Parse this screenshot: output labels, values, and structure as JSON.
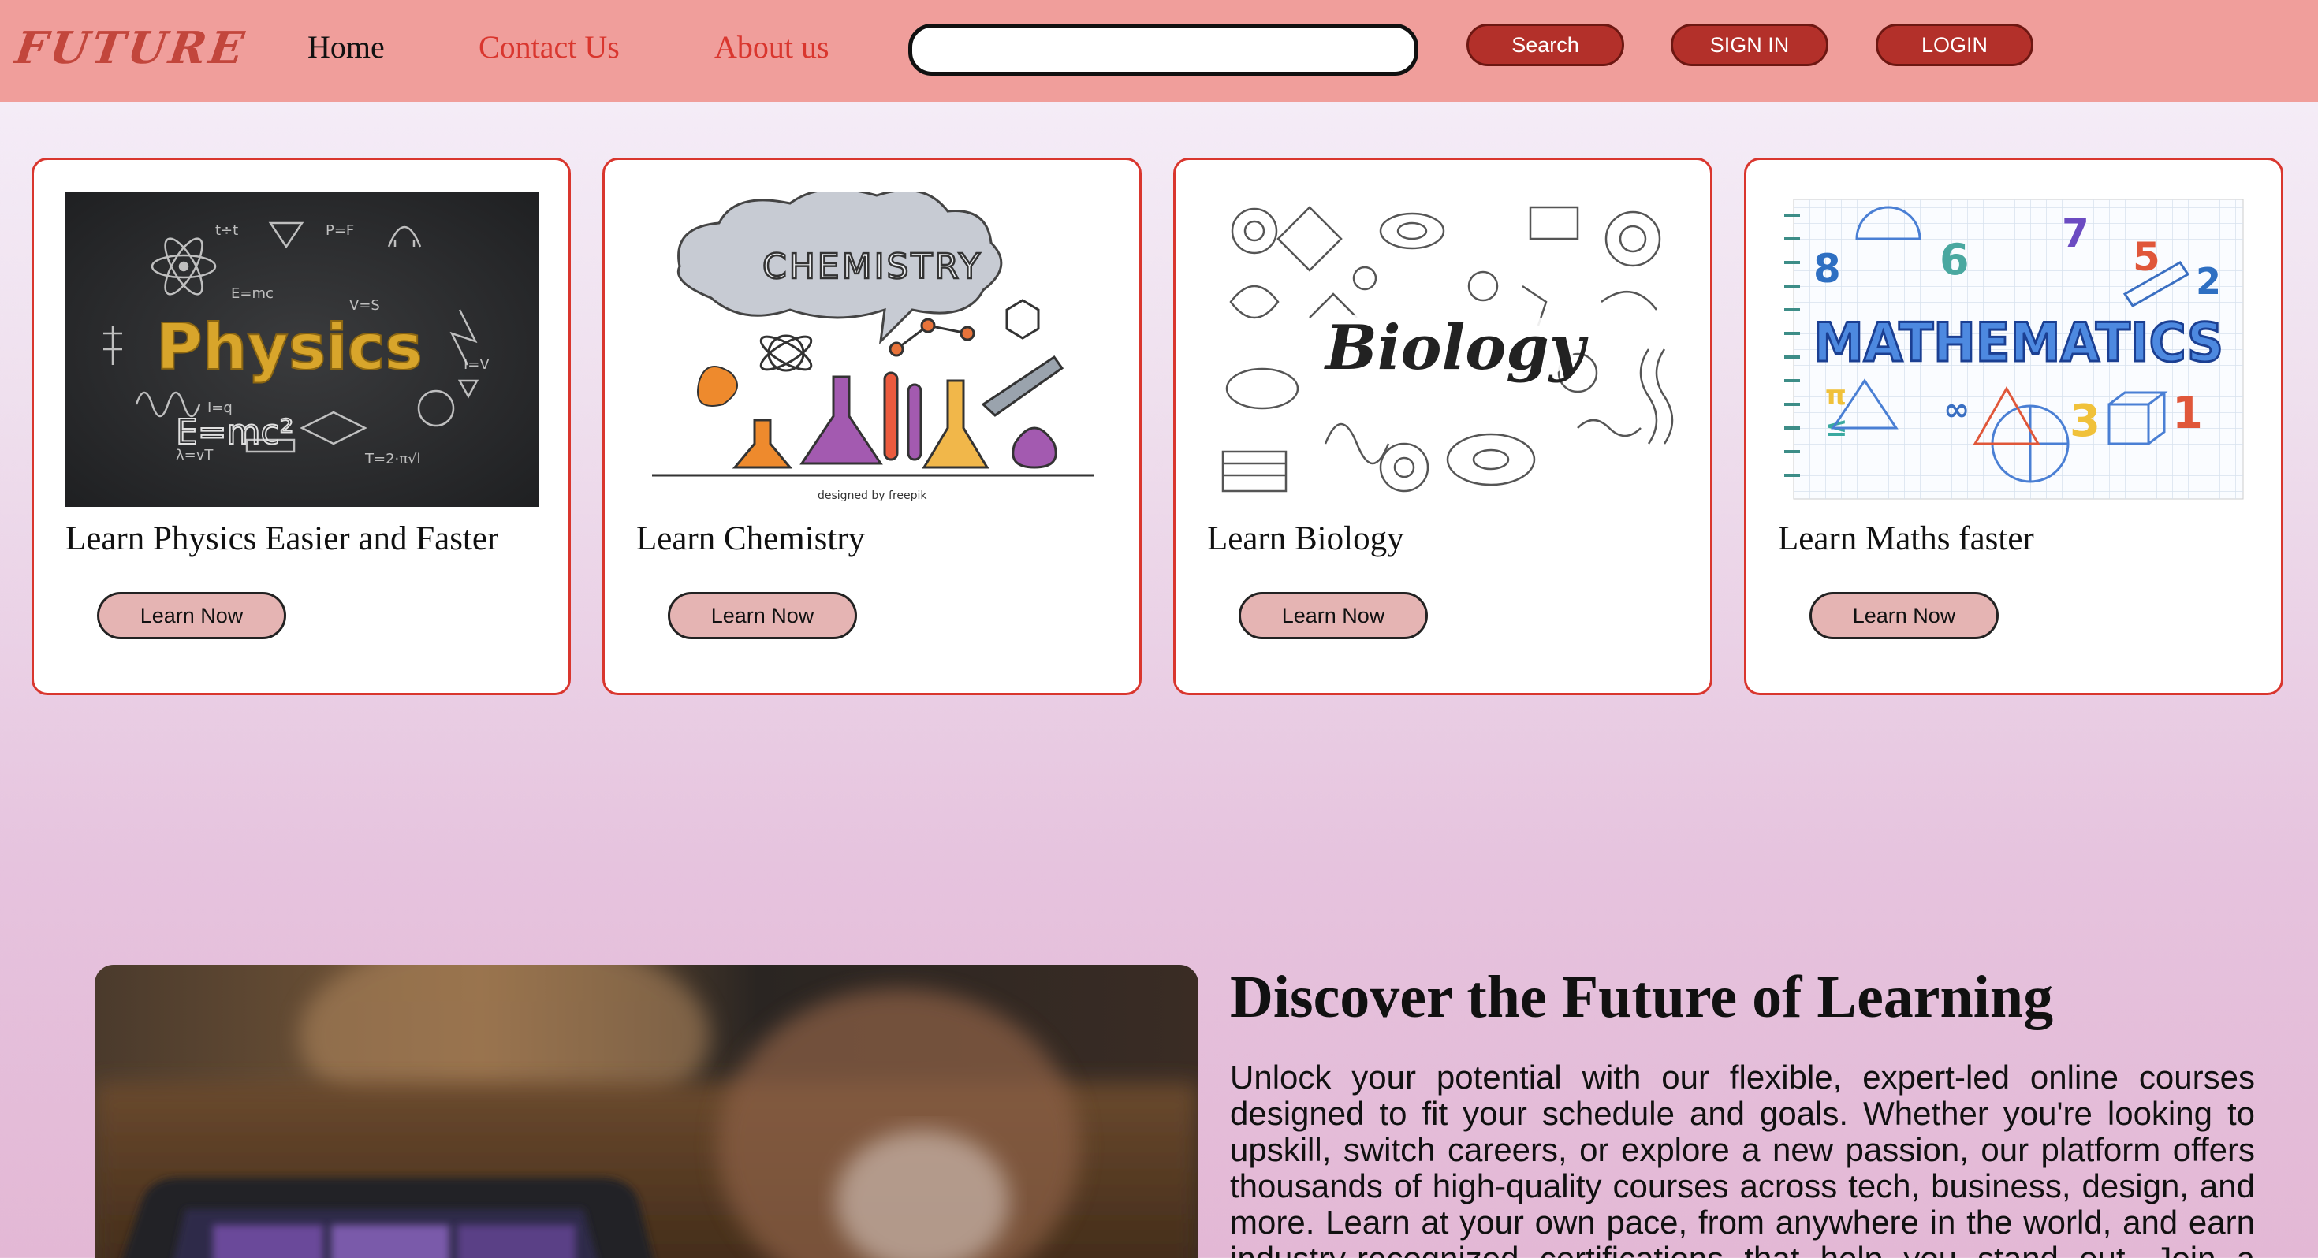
{
  "header": {
    "logo": "FUTURE",
    "nav": {
      "home": "Home",
      "contact": "Contact Us",
      "about": "About us"
    },
    "search": {
      "value": "",
      "placeholder": ""
    },
    "buttons": {
      "search": "Search",
      "signin": "SIGN IN",
      "login": "LOGIN"
    }
  },
  "cards": [
    {
      "title": "Learn Physics Easier and Faster",
      "button": "Learn Now",
      "image_label": "Physics"
    },
    {
      "title": "Learn Chemistry",
      "button": "Learn Now",
      "image_label": "CHEMISTRY",
      "credit": "designed by freepik"
    },
    {
      "title": "Learn Biology",
      "button": "Learn Now",
      "image_label": "Biology"
    },
    {
      "title": "Learn Maths faster",
      "button": "Learn Now",
      "image_label": "MATHEMATICS"
    }
  ],
  "discover": {
    "title": "Discover the Future of Learning",
    "text": "Unlock your potential with our flexible, expert-led online courses designed to fit your schedule and goals. Whether you're looking to upskill, switch careers, or explore a new passion, our platform offers thousands of high-quality courses across tech, business, design, and more. Learn at your own pace, from anywhere in the world, and earn industry-recognized certifications that help you stand out. Join a global"
  },
  "colors": {
    "navbar": "#f09e9b",
    "accent": "#d9362e",
    "button_dark": "#b3302a",
    "learn_button": "#e5b4b3"
  }
}
